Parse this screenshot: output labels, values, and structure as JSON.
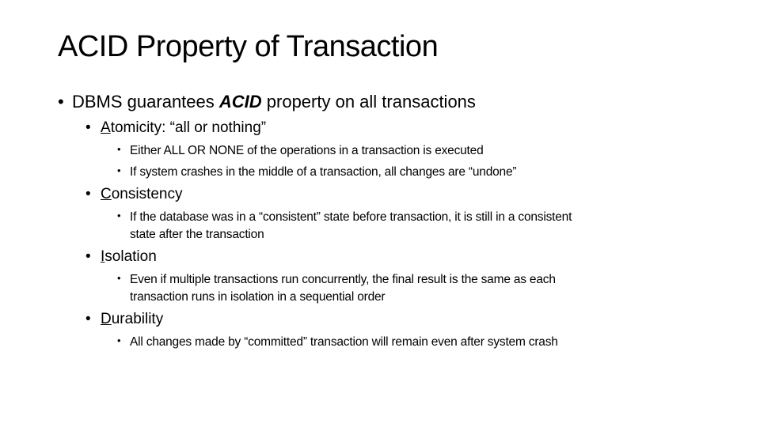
{
  "slide": {
    "title": "ACID Property of Transaction",
    "bullet_glyph": "•",
    "main_bullet": {
      "prefix": "DBMS guarantees ",
      "emphasis": "ACID",
      "suffix": " property on all transactions"
    },
    "properties": [
      {
        "initial": "A",
        "rest": "tomicity: “all or nothing”",
        "details": [
          "Either ALL OR NONE of the operations in a transaction is executed",
          "If system crashes in the middle of a transaction, all changes are “undone”"
        ]
      },
      {
        "initial": "C",
        "rest": "onsistency",
        "details": [
          "If the database was in a “consistent” state before transaction, it is still in a consistent",
          "state after the transaction"
        ]
      },
      {
        "initial": "I",
        "rest": "solation",
        "details": [
          "Even if multiple transactions run concurrently, the final result is the same as each",
          "transaction runs in isolation in a sequential order"
        ]
      },
      {
        "initial": "D",
        "rest": "urability",
        "details": [
          "All changes made by “committed” transaction will remain even after system crash"
        ]
      }
    ]
  }
}
